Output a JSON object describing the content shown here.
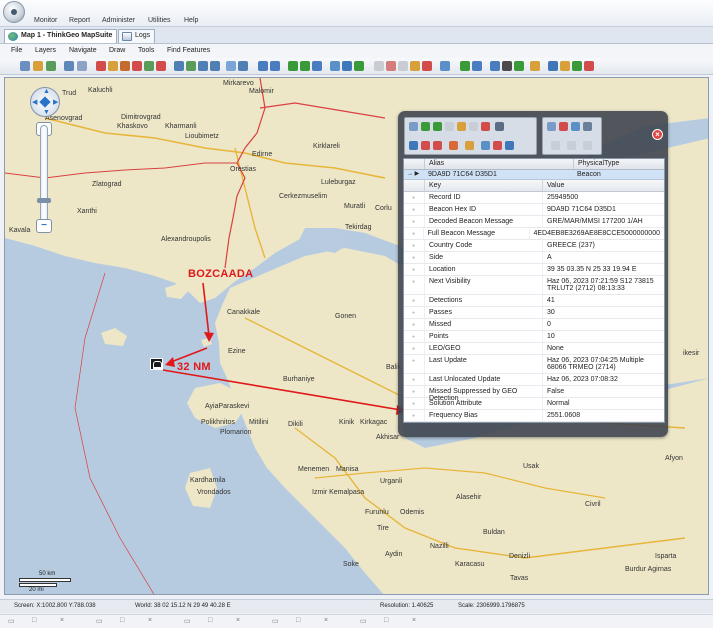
{
  "menubar": {
    "items": [
      "Monitor",
      "Report",
      "Administer",
      "Utilities",
      "Help"
    ]
  },
  "tabs": [
    {
      "label": "Map 1 - ThinkGeo MapSuite"
    },
    {
      "label": "Logs"
    }
  ],
  "submenu": {
    "items": [
      "File",
      "Layers",
      "Navigate",
      "Draw",
      "Tools",
      "Find Features"
    ]
  },
  "map": {
    "places": {
      "trud": "Trud",
      "kaluchli": "Kaluchli",
      "mirkarevo": "Mirkarevo",
      "malomir": "Malomir",
      "asenovgrad": "Asenovgrad",
      "dimitrovgrad": "Dimitrovgrad",
      "khaskovo": "Khaskovo",
      "kharmanli": "Kharmanli",
      "lioubimetz": "Lioubimetz",
      "edirne": "Edirne",
      "kirklareli": "Kirklareli",
      "orestias": "Orestias",
      "luleburgaz": "Luleburgaz",
      "zlatograd": "Zlatograd",
      "cerkezmuselim": "Cerkezmuselim",
      "muratli": "Muratli",
      "corlu": "Corlu",
      "xanthi": "Xanthi",
      "tekirdag": "Tekirdag",
      "kavala": "Kavala",
      "alexandroupolis": "Alexandroupolis",
      "canakkale": "Canakkale",
      "gonen": "Gonen",
      "ezine": "Ezine",
      "balikesir_left": "Balik",
      "balikesir_right": "ikesir",
      "burhaniye": "Burhaniye",
      "ayiaparaskevi": "AyiaParaskevi",
      "polikhnitos": "Polikhnitos",
      "mitilini": "Mitilini",
      "plomarion": "Plomarion",
      "dikili": "Dikili",
      "kinik": "Kinik",
      "kirkagac": "Kirkagac",
      "akhisar": "Akhisar",
      "afyon": "Afyon",
      "menemen": "Menemen",
      "manisa": "Manisa",
      "usak": "Usak",
      "kardhamila": "Kardhamila",
      "vrondados": "Vrondados",
      "izmir": "Izmir Kemalpasa",
      "urganli": "Urganli",
      "alasehir": "Alasehir",
      "furunlu": "Furunlu",
      "odemis": "Odemis",
      "civril": "Civril",
      "tire": "Tire",
      "buldan": "Buldan",
      "nazilli": "Nazilli",
      "aydin": "Aydin",
      "soke": "Soke",
      "karacasu": "Karacasu",
      "denizli": "Denizli",
      "isparta": "Isparta",
      "burdur": "Burdur Agirnas",
      "tavas": "Tavas"
    },
    "annotations": {
      "island_label": "BOZCAADA",
      "distance_label": "32 NM"
    },
    "scale": {
      "km": "50 km",
      "mi": "20 mi"
    },
    "colors": {
      "land": "#ede7c8",
      "sea": "#b8cbe0",
      "border": "#d94040",
      "roads": "#e8b53b",
      "annotation": "#e01818"
    }
  },
  "panel": {
    "header": {
      "alias": "Alias",
      "physical_type": "PhysicalType"
    },
    "selected_row": {
      "marker": "→ ▶",
      "alias": "9DA9D 71C64 D35D1",
      "physical_type": "Beacon"
    },
    "subheader": {
      "key": "Key",
      "value": "Value"
    },
    "properties": [
      {
        "key": "Record ID",
        "value": "25949500"
      },
      {
        "key": "Beacon Hex ID",
        "value": "9DA9D 71C64 D35D1"
      },
      {
        "key": "Decoded Beacon Message",
        "value": "GRE/MAR/MMSI 177200 1/AH"
      },
      {
        "key": "Full Beacon Message",
        "value": "4ED4EB8E3269AE8E8CCE5000000000"
      },
      {
        "key": "Country Code",
        "value": "GREECE (237)"
      },
      {
        "key": "Side",
        "value": "A"
      },
      {
        "key": "Location",
        "value": "39 35 03.35 N  25 33 19.94 E"
      },
      {
        "key": "Next Visibility",
        "value": "Haz 06, 2023 07:21:59 S12 73815 TRLUT2 (2712) 08:13:33"
      },
      {
        "key": "Detections",
        "value": "41"
      },
      {
        "key": "Passes",
        "value": "30"
      },
      {
        "key": "Missed",
        "value": "0"
      },
      {
        "key": "Points",
        "value": "10"
      },
      {
        "key": "LEO/GEO",
        "value": "None"
      },
      {
        "key": "Last Update",
        "value": "Haz 06, 2023 07:04:25 Multiple 68066 TRMEO (2714)"
      },
      {
        "key": "Last Unlocated Update",
        "value": "Haz 06, 2023 07:08:32"
      },
      {
        "key": "Missed Suppressed by GEO Detection",
        "value": "False"
      },
      {
        "key": "Solution Attribute",
        "value": "Normal"
      },
      {
        "key": "Frequency Bias",
        "value": "2551.0608"
      }
    ]
  },
  "statusbar": {
    "screen": "Screen: X:1002.800 Y:788.038",
    "world": "World: 38 02 15.12 N  29 49 40.28 E",
    "resolution": "Resolution: 1.40625",
    "scale": "Scale: 2306999.1796875"
  }
}
